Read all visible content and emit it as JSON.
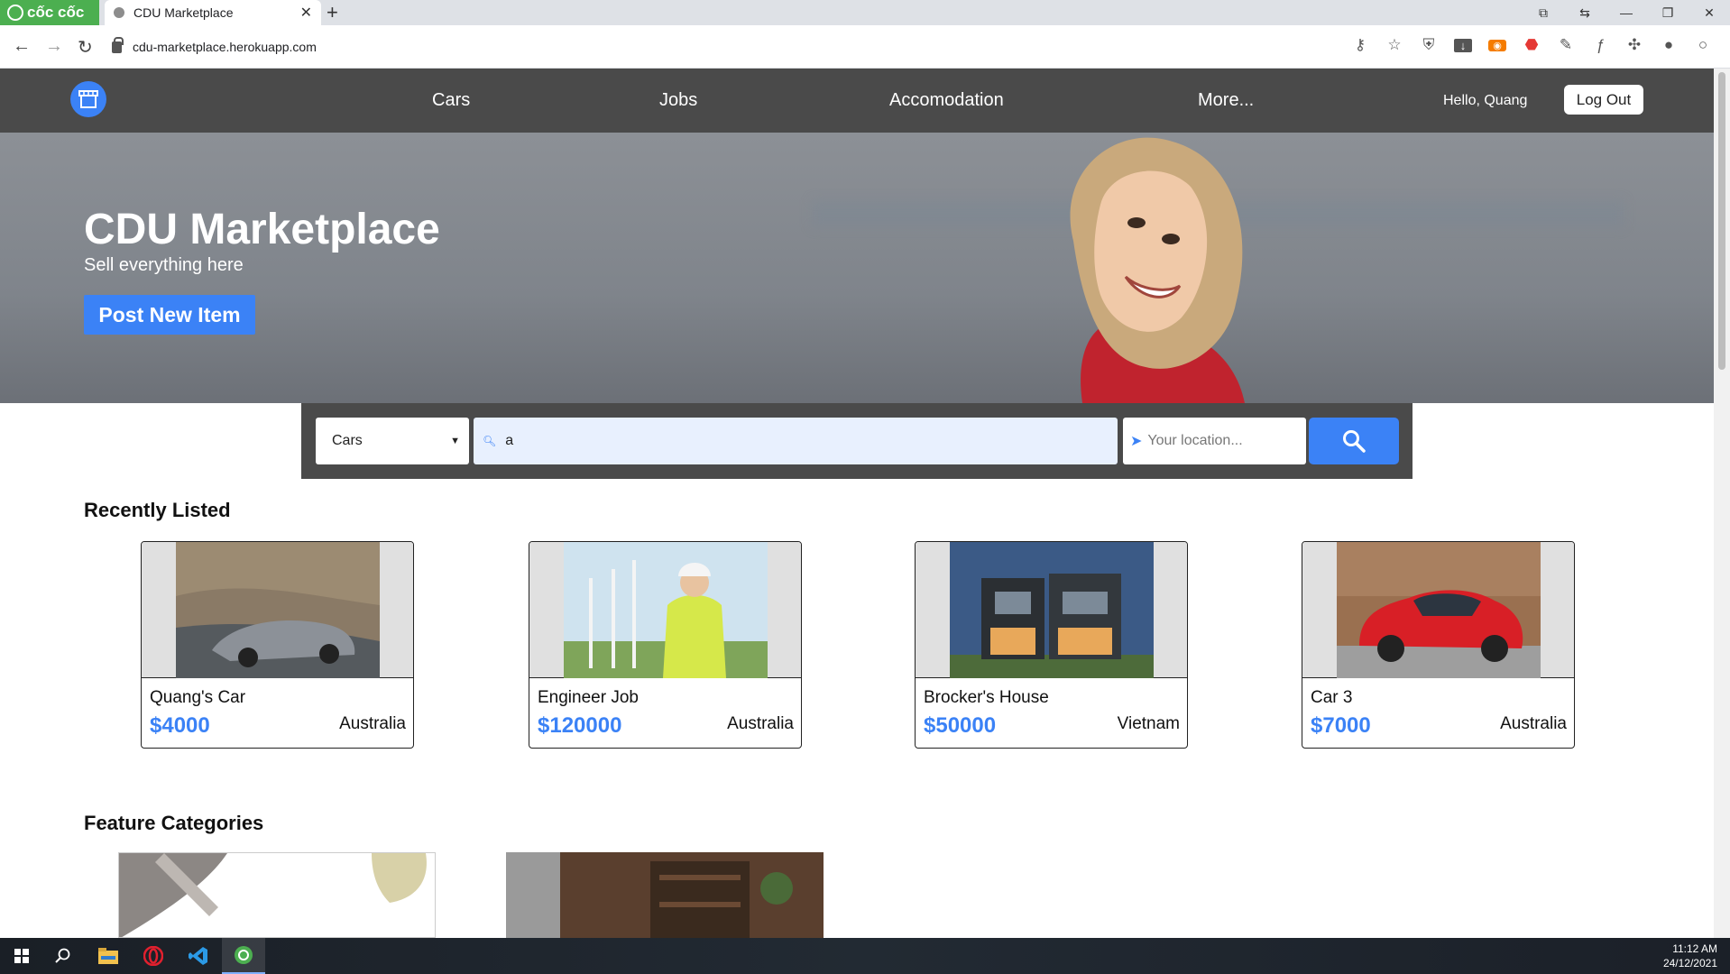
{
  "browser": {
    "brand_label": "cốc cốc",
    "tab_title": "CDU Marketplace",
    "tab_close": "✕",
    "new_tab": "+",
    "url": "cdu-marketplace.herokuapp.com"
  },
  "nav": {
    "links": [
      "Cars",
      "Jobs",
      "Accomodation",
      "More..."
    ],
    "greeting": "Hello, Quang",
    "logout_label": "Log Out"
  },
  "hero": {
    "title": "CDU Marketplace",
    "subtitle": "Sell everything here",
    "cta_label": "Post New Item"
  },
  "search": {
    "category_value": "Cars",
    "query_value": "a",
    "location_placeholder": "Your location..."
  },
  "recent": {
    "title": "Recently Listed",
    "items": [
      {
        "title": "Quang's Car",
        "price": "$4000",
        "location": "Australia",
        "image": "grey-sedan-photo"
      },
      {
        "title": "Engineer Job",
        "price": "$120000",
        "location": "Australia",
        "image": "engineer-wind-farm-photo"
      },
      {
        "title": "Brocker's House",
        "price": "$50000",
        "location": "Vietnam",
        "image": "modern-house-photo"
      },
      {
        "title": "Car 3",
        "price": "$7000",
        "location": "Australia",
        "image": "red-hatchback-photo"
      }
    ]
  },
  "features": {
    "title": "Feature Categories"
  },
  "taskbar": {
    "time": "11:12 AM",
    "date": "24/12/2021"
  },
  "colors": {
    "accent": "#3b82f6",
    "nav_bg": "#4a4a4a",
    "brand_green": "#4caf50"
  }
}
